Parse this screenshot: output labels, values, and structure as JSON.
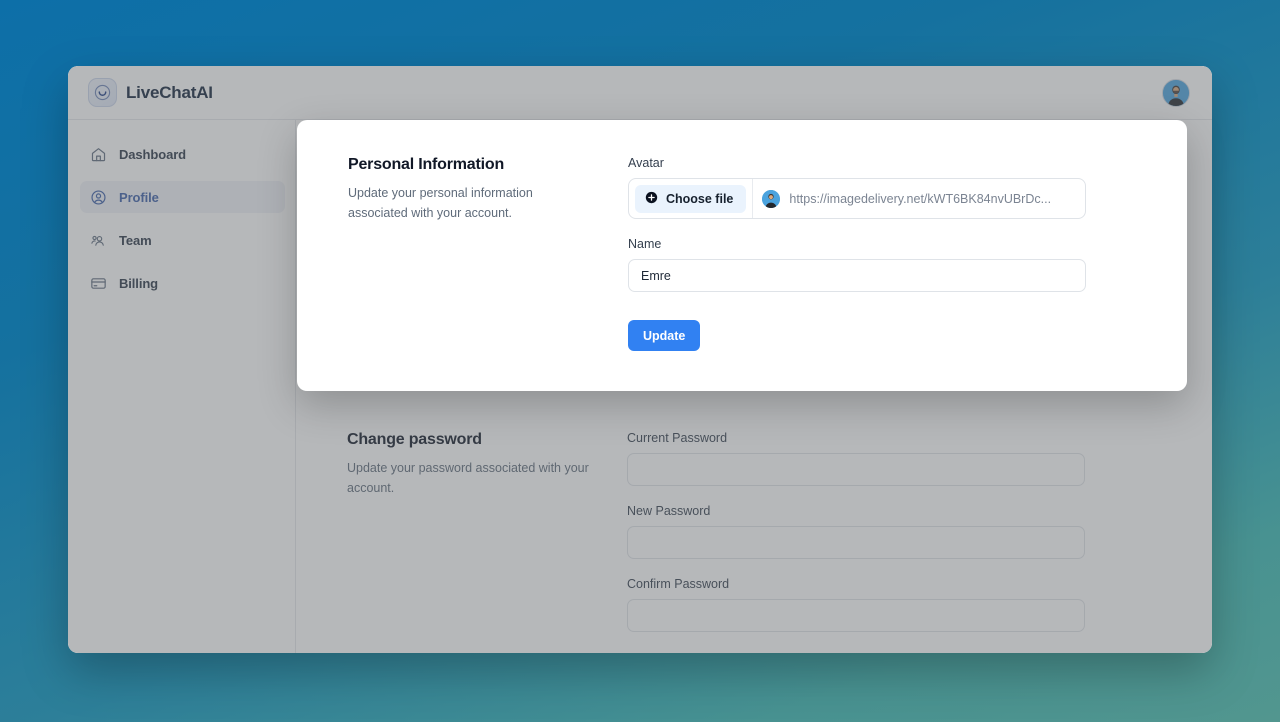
{
  "theme": {
    "accent_blue": "#3181f2",
    "nav_active_text": "#3c5fa8",
    "bg_gradient_top": "#0d6fa8",
    "bg_gradient_bottom": "#52968f",
    "choose_file_bg": "#eaf3fd"
  },
  "header": {
    "brand_name": "LiveChatAI",
    "logo_icon": "chat-smile-icon",
    "avatar_icon": "user-avatar"
  },
  "sidebar": {
    "items": [
      {
        "label": "Dashboard",
        "icon": "home-icon",
        "active": false
      },
      {
        "label": "Profile",
        "icon": "user-circle-icon",
        "active": true
      },
      {
        "label": "Team",
        "icon": "users-group-icon",
        "active": false
      },
      {
        "label": "Billing",
        "icon": "credit-card-icon",
        "active": false
      }
    ]
  },
  "personal_information": {
    "title": "Personal Information",
    "description": "Update your personal information associated with your account.",
    "avatar_label": "Avatar",
    "choose_file_label": "Choose file",
    "choose_file_icon": "plus-circle-icon",
    "avatar_url": "https://imagedelivery.net/kWT6BK84nvUBrDc...",
    "name_label": "Name",
    "name_value": "Emre",
    "name_placeholder": "Name",
    "update_label": "Update"
  },
  "change_password": {
    "title": "Change password",
    "description": "Update your password associated with your account.",
    "fields": [
      {
        "label": "Current Password",
        "value": "",
        "placeholder": ""
      },
      {
        "label": "New Password",
        "value": "",
        "placeholder": ""
      },
      {
        "label": "Confirm Password",
        "value": "",
        "placeholder": ""
      }
    ]
  }
}
